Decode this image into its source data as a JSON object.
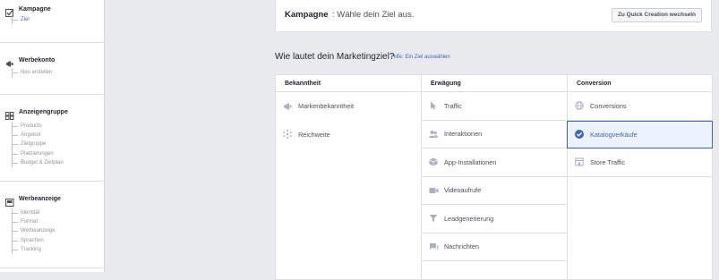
{
  "colors": {
    "accent": "#4267b2",
    "icon_grey": "#aab1c4",
    "selected_bg": "#ecf3ff"
  },
  "sidebar": {
    "sections": [
      {
        "title": "Kampagne",
        "icon": "checkbox-icon",
        "items": [
          {
            "label": "Ziel",
            "active": true
          }
        ]
      },
      {
        "title": "Werbekonto",
        "icon": "megaphone-icon",
        "items": [
          {
            "label": "Neu erstellen",
            "active": false
          }
        ]
      },
      {
        "title": "Anzeigengruppe",
        "icon": "grid-icon",
        "items": [
          {
            "label": "Products"
          },
          {
            "label": "Angebot"
          },
          {
            "label": "Zielgruppe"
          },
          {
            "label": "Platzierungen"
          },
          {
            "label": "Budget & Zeitplan"
          }
        ]
      },
      {
        "title": "Werbeanzeige",
        "icon": "ad-frame-icon",
        "items": [
          {
            "label": "Identität"
          },
          {
            "label": "Format"
          },
          {
            "label": "Werbeanzeige"
          },
          {
            "label": "Sprachen"
          },
          {
            "label": "Tracking"
          }
        ]
      }
    ]
  },
  "header": {
    "title": "Kampagne",
    "subtitle": ": Wähle dein Ziel aus.",
    "quick_creation_button": "Zu Quick Creation wechseln"
  },
  "objective": {
    "question": "Wie lautet dein Marketingziel?",
    "help_link": "Hilfe: Ein Ziel auswählen",
    "columns": [
      {
        "header": "Bekanntheit",
        "items": [
          {
            "label": "Markenbekanntheit",
            "icon": "megaphone-icon"
          },
          {
            "label": "Reichweite",
            "icon": "snowflake-icon"
          }
        ]
      },
      {
        "header": "Erwägung",
        "items": [
          {
            "label": "Traffic",
            "icon": "cursor-icon"
          },
          {
            "label": "Interaktionen",
            "icon": "people-icon"
          },
          {
            "label": "App-Installationen",
            "icon": "box-icon"
          },
          {
            "label": "Videoaufrufe",
            "icon": "video-icon"
          },
          {
            "label": "Leadgenerierung",
            "icon": "funnel-icon"
          },
          {
            "label": "Nachrichten",
            "icon": "chat-icon"
          }
        ]
      },
      {
        "header": "Conversion",
        "items": [
          {
            "label": "Conversions",
            "icon": "globe-icon"
          },
          {
            "label": "Katalogverkäufe",
            "icon": "check-circle-icon",
            "selected": true
          },
          {
            "label": "Store Traffic",
            "icon": "store-icon"
          }
        ]
      }
    ]
  }
}
